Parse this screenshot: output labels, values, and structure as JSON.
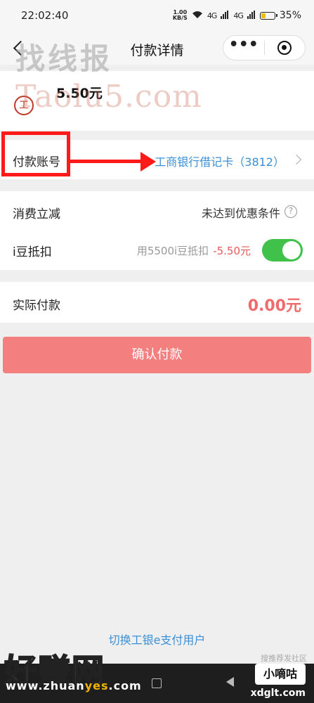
{
  "status_bar": {
    "time": "22:02:40",
    "net_speed": "1.00",
    "net_unit": "KB/S",
    "signal1": "4G",
    "signal2": "4G",
    "battery_pct": "35%",
    "battery_level": 0.35
  },
  "nav": {
    "title": "付款详情",
    "more_glyph": "•••"
  },
  "watermarks": {
    "top_text": "找线报",
    "site_text": "Taolu5.com",
    "bottom_text": "好赚网",
    "bottom_url_prefix": "www.zhuan",
    "bottom_url_highlight": "yes",
    "bottom_url_suffix": ".com",
    "right_small": "搜推荐发社区",
    "right_box": "小嘀咕",
    "right_url": "xdglt.com"
  },
  "payment": {
    "amount": "5.50元",
    "bank_logo_glyph": "工",
    "account_label": "付款账号",
    "account_value": "工商银行借记卡（3812）",
    "discount_label": "消费立减",
    "discount_value": "未达到优惠条件",
    "help_glyph": "?",
    "beans_label": "i豆抵扣",
    "beans_desc": "用5500i豆抵扣",
    "beans_amount": "-5.50元",
    "beans_enabled": true,
    "actual_label": "实际付款",
    "actual_value": "0.00元",
    "confirm_label": "确认付款",
    "switch_user_link": "切换工银e支付用户"
  },
  "colors": {
    "accent_blue": "#3b8fd6",
    "confirm_button": "#f47f7f",
    "amount_red": "#f06b6b",
    "toggle_green": "#3fc14a",
    "annotation_red": "#ff1a1a"
  }
}
